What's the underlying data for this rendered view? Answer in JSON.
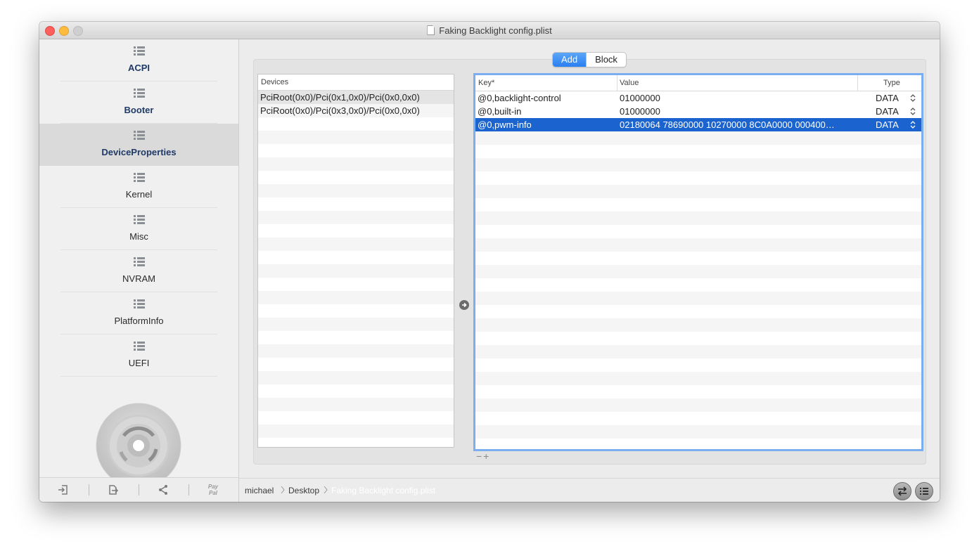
{
  "window": {
    "title": "Faking Backlight config.plist"
  },
  "sidebar": {
    "items": [
      {
        "label": "ACPI",
        "bold": true
      },
      {
        "label": "Booter",
        "bold": true
      },
      {
        "label": "DeviceProperties",
        "bold": true,
        "selected": true
      },
      {
        "label": "Kernel"
      },
      {
        "label": "Misc"
      },
      {
        "label": "NVRAM"
      },
      {
        "label": "PlatformInfo"
      },
      {
        "label": "UEFI"
      }
    ],
    "toolbar": {
      "paypal_line1": "Pay",
      "paypal_line2": "Pal"
    }
  },
  "segmented": {
    "add_label": "Add",
    "block_label": "Block",
    "selected": "Add"
  },
  "devices_table": {
    "header": "Devices",
    "rows": [
      "PciRoot(0x0)/Pci(0x1,0x0)/Pci(0x0,0x0)",
      "PciRoot(0x0)/Pci(0x3,0x0)/Pci(0x0,0x0)"
    ],
    "plus_minus": "−+"
  },
  "properties_table": {
    "headers": {
      "key": "Key*",
      "value": "Value",
      "type": "Type"
    },
    "rows": [
      {
        "key": "@0,backlight-control",
        "value": "01000000",
        "type": "DATA"
      },
      {
        "key": "@0,built-in",
        "value": "01000000",
        "type": "DATA"
      },
      {
        "key": "@0,pwm-info",
        "value": "02180064 78690000 10270000 8C0A0000 000400…",
        "type": "DATA",
        "selected": true
      }
    ],
    "plus_minus": "−+"
  },
  "path_bar": {
    "crumbs": [
      "michael",
      "Desktop",
      "Faking Backlight config.plist"
    ]
  },
  "colors": {
    "selection": "#1b64d0",
    "segment_active": "#2a7ff1",
    "focus_ring": "#7aaef0"
  }
}
